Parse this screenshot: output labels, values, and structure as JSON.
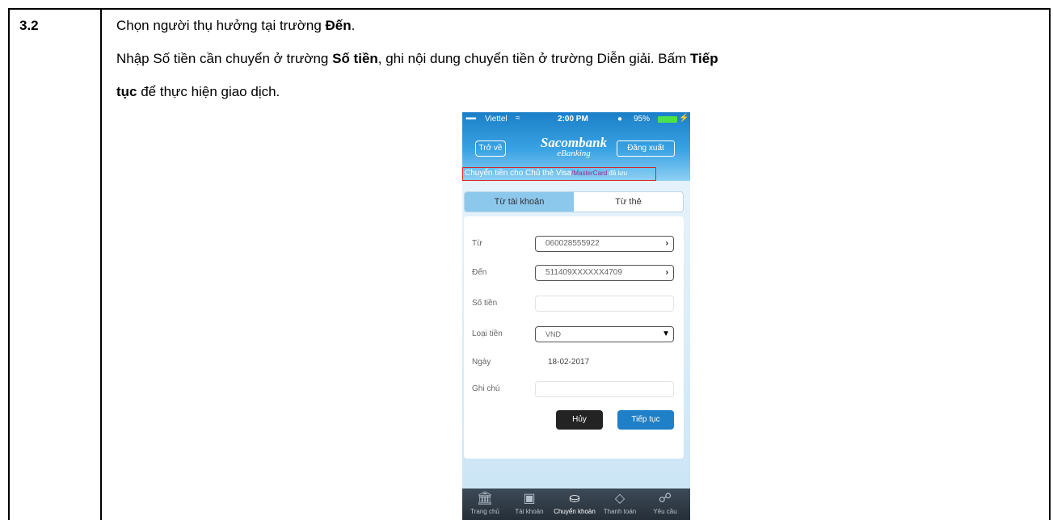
{
  "step": "3.2",
  "instructions": {
    "line1_pre": "Chọn người thụ hưởng tại trường ",
    "line1_bold": "Đến",
    "line1_post": ".",
    "line2_pre": "Nhập Số tiền cần chuyển ở trường ",
    "line2_bold": "Số tiền",
    "line2_post": ", ghi nội dung chuyển tiền ở trường Diễn giải. Bấm ",
    "line2_bold2": "Tiếp",
    "line3_bold": "tục",
    "line3_post": " để thực hiện giao dịch."
  },
  "phone": {
    "status": {
      "dots": "•••••",
      "carrier": "Viettel",
      "time": "2:00 PM",
      "battery": "95%"
    },
    "header": {
      "back": "Trở về",
      "logo_main": "Sacombank",
      "logo_sub": "eBanking",
      "logout": "Đăng xuất"
    },
    "title": {
      "pre": "Chuyển tiền cho Chủ thẻ Visa",
      "mc": "/MasterCard",
      "post": " đã lưu"
    },
    "tabs": {
      "from_account": "Từ tài khoản",
      "from_card": "Từ thẻ"
    },
    "form": {
      "from_label": "Từ",
      "from_value": "060028555922",
      "to_label": "Đến",
      "to_value": "511409XXXXXX4709",
      "amount_label": "Số tiền",
      "amount_value": "",
      "currency_label": "Loại tiền",
      "currency_value": "VND",
      "date_label": "Ngày",
      "date_value": "18-02-2017",
      "note_label": "Ghi chú",
      "note_value": ""
    },
    "buttons": {
      "cancel": "Hủy",
      "next": "Tiếp tục"
    },
    "nav": [
      "Trang chủ",
      "Tài khoản",
      "Chuyển khoản",
      "Thanh toán",
      "Yêu cầu"
    ]
  }
}
